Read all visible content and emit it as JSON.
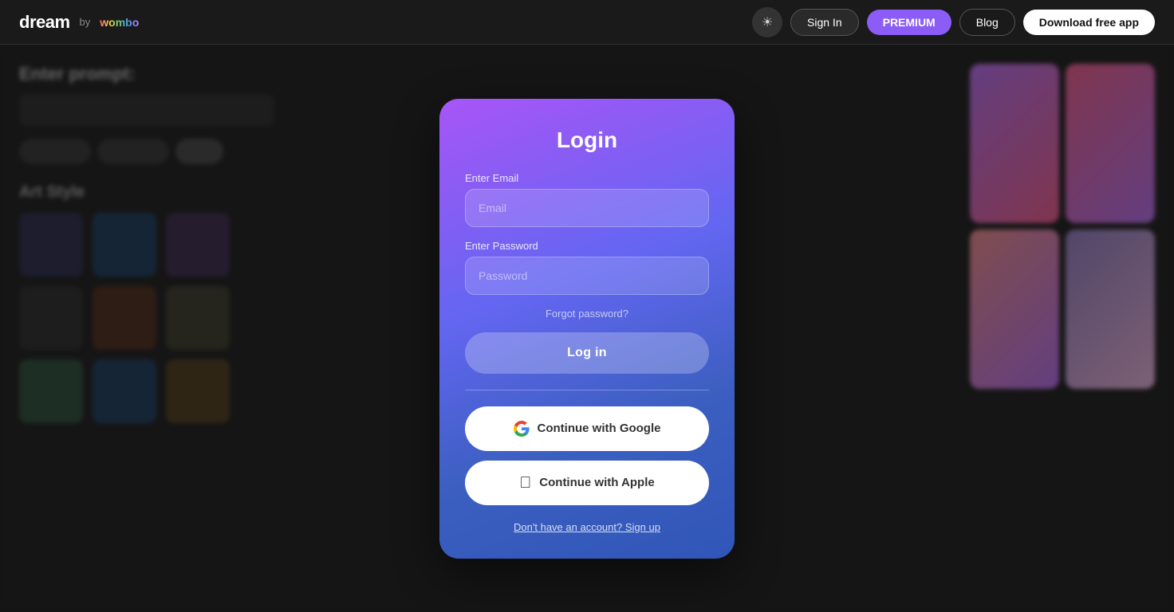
{
  "navbar": {
    "logo_dream": "dream",
    "logo_by": "by",
    "logo_wombo": "wombo",
    "sign_in_label": "Sign In",
    "premium_label": "PREMIUM",
    "blog_label": "Blog",
    "download_label": "Download free app",
    "theme_icon": "☀"
  },
  "modal": {
    "title": "Login",
    "email_label": "Enter Email",
    "email_placeholder": "Email",
    "password_label": "Enter Password",
    "password_placeholder": "Password",
    "forgot_password_label": "Forgot password?",
    "login_button_label": "Log in",
    "google_button_label": "Continue with Google",
    "apple_button_label": "Continue with Apple",
    "signup_link_label": "Don't have an account? Sign up"
  },
  "background": {
    "prompt_label": "Enter prompt:",
    "art_style_label": "Art Style"
  }
}
